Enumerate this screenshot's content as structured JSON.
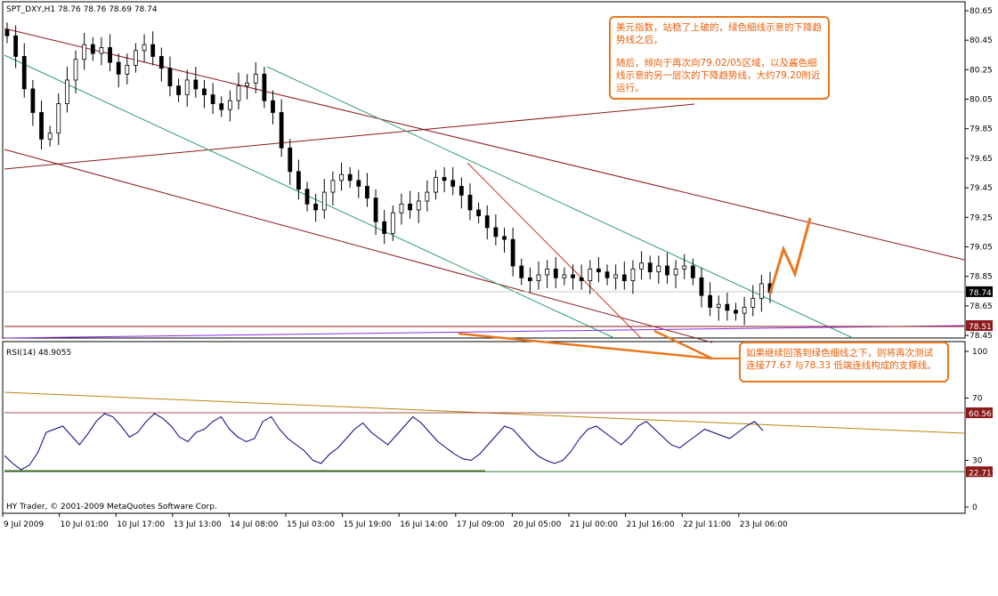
{
  "chart_data": {
    "type": "candlestick",
    "symbol_header": "SPT_DXY,H1  78.76 78.76 78.69 78.74",
    "price_axis": {
      "ticks": [
        "80.65",
        "80.45",
        "80.25",
        "80.05",
        "79.85",
        "79.65",
        "79.45",
        "79.25",
        "79.05",
        "78.85",
        "78.65",
        "78.45"
      ],
      "ylim": [
        78.43,
        80.68
      ],
      "current_price_label": "78.74",
      "current_price": 78.74,
      "level_label": "78.51",
      "level": 78.51
    },
    "time_axis": {
      "labels": [
        "9 Jul 2009",
        "10 Jul 01:00",
        "10 Jul 17:00",
        "13 Jul 13:00",
        "14 Jul 08:00",
        "15 Jul 03:00",
        "15 Jul 19:00",
        "16 Jul 14:00",
        "17 Jul 09:00",
        "20 Jul 05:00",
        "21 Jul 00:00",
        "21 Jul 16:00",
        "22 Jul 11:00",
        "23 Jul 06:00"
      ]
    },
    "close_series": [
      80.48,
      80.34,
      80.12,
      79.96,
      79.78,
      79.82,
      80.02,
      80.18,
      80.32,
      80.42,
      80.36,
      80.4,
      80.3,
      80.22,
      80.28,
      80.38,
      80.42,
      80.34,
      80.26,
      80.14,
      80.08,
      80.18,
      80.12,
      80.08,
      80.02,
      79.98,
      80.04,
      80.14,
      80.16,
      80.22,
      80.04,
      79.96,
      79.72,
      79.56,
      79.44,
      79.34,
      79.3,
      79.42,
      79.5,
      79.54,
      79.5,
      79.46,
      79.38,
      79.22,
      79.14,
      79.28,
      79.34,
      79.3,
      79.36,
      79.42,
      79.52,
      79.5,
      79.46,
      79.4,
      79.3,
      79.26,
      79.18,
      79.12,
      79.1,
      78.92,
      78.84,
      78.82,
      78.86,
      78.9,
      78.84,
      78.86,
      78.84,
      78.82,
      78.9,
      78.88,
      78.84,
      78.86,
      78.82,
      78.9,
      78.94,
      78.88,
      78.92,
      78.86,
      78.9,
      78.92,
      78.84,
      78.72,
      78.64,
      78.66,
      78.62,
      78.6,
      78.64,
      78.7,
      78.8,
      78.74
    ],
    "rsi": {
      "label": "RSI(14) 48.9055",
      "ticks": [
        "100",
        "70",
        "30",
        "0"
      ],
      "ylim": [
        0,
        100
      ],
      "level_high_label": "60.56",
      "level_high": 60.56,
      "level_low_label": "22.71",
      "level_low": 22.71,
      "values": [
        33,
        28,
        24,
        27,
        35,
        48,
        50,
        52,
        46,
        40,
        47,
        55,
        60,
        58,
        52,
        45,
        48,
        55,
        60,
        57,
        52,
        45,
        42,
        48,
        50,
        55,
        58,
        50,
        45,
        42,
        44,
        55,
        58,
        50,
        44,
        40,
        36,
        30,
        28,
        34,
        38,
        44,
        50,
        54,
        48,
        44,
        40,
        46,
        52,
        58,
        54,
        48,
        42,
        38,
        34,
        31,
        30,
        34,
        40,
        46,
        52,
        50,
        44,
        38,
        33,
        30,
        28,
        30,
        36,
        44,
        50,
        52,
        48,
        44,
        40,
        45,
        52,
        55,
        50,
        45,
        40,
        38,
        42,
        46,
        50,
        48,
        46,
        44,
        48,
        52,
        55,
        49
      ]
    },
    "trendlines": [],
    "colors": {
      "bull": "#ffffff",
      "bear": "#000000",
      "channel_red": "#8b1a1a",
      "channel_green": "#2e9e6a",
      "purple": "#8a2be2",
      "orange": "#e8771e",
      "rsi": "#000080",
      "rsi_trend": "#b8860b",
      "rsi_support": "#2e7d32"
    }
  },
  "annotations": {
    "top_note_line1": "美元指数，站稳了上破的，绿色细线示意的下降趋势线之后，",
    "top_note_line2": "随后，倾向于再次向79.02/05区域，以及酱色细线示意的另一层次的下降趋势线，大约79.20附近运行。",
    "bottom_note": "如果继续回落到绿色细线之下，则将再次测试连接77.67 与78.33 低端连线构成的支撑线。"
  },
  "footer": {
    "copyright": "HY Trader, © 2001-2009 MetaQuotes Software Corp."
  }
}
